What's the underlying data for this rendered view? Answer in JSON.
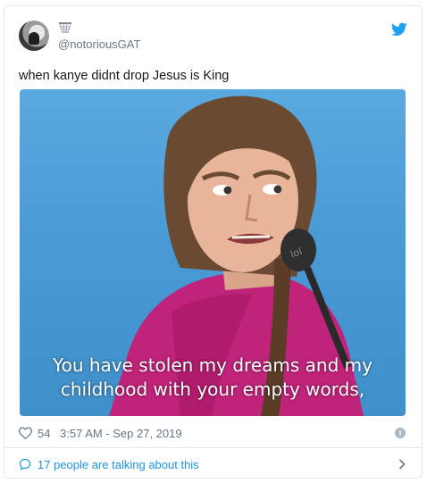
{
  "tweet": {
    "handle": "@notoriousGAT",
    "text": "when kanye didnt drop Jesus is King",
    "media": {
      "caption_line1": "You have stolen my dreams and my",
      "caption_line2": "childhood with your empty words,",
      "mic_text": "lol"
    },
    "likes": "54",
    "timestamp": "3:57 AM - Sep 27, 2019",
    "talking": "17 people are talking about this"
  },
  "colors": {
    "twitter_blue": "#1da1f2",
    "link_blue": "#1b95e0",
    "secondary_text": "#657786",
    "border": "#e1e8ed"
  },
  "icons": [
    "avatar",
    "basketball-net-emoji-icon",
    "twitter-bird-icon",
    "heart-icon",
    "info-icon",
    "speech-bubble-icon",
    "chevron-right-icon"
  ]
}
